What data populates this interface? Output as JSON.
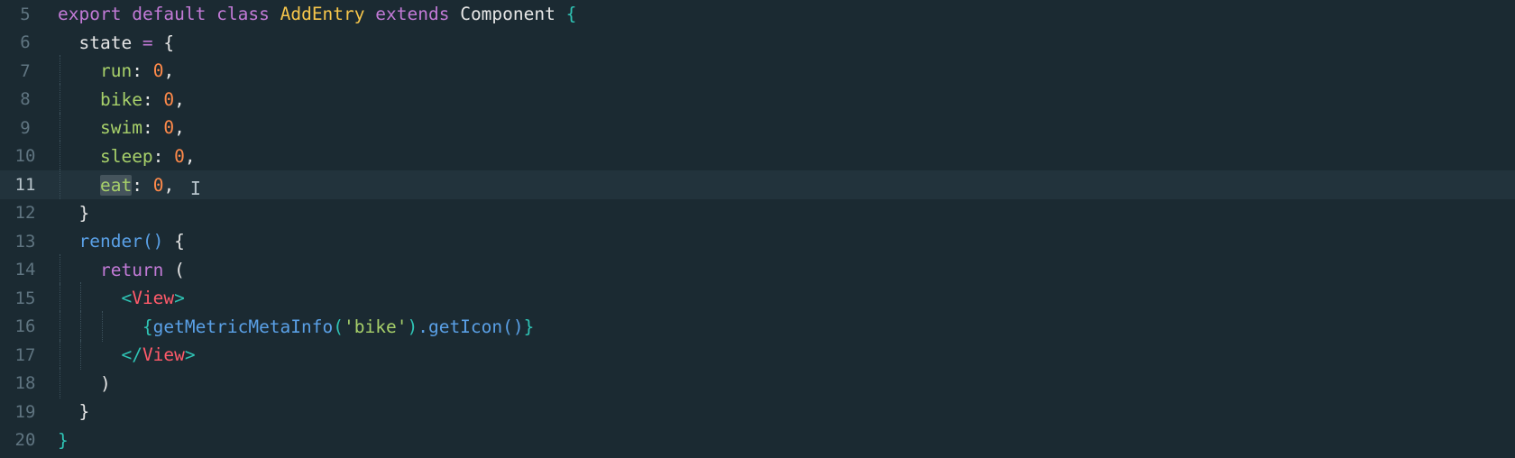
{
  "editor": {
    "active_line": "11",
    "cursor_glyph": "I",
    "lines": [
      {
        "no": "5",
        "tokens": [
          [
            "kw",
            "export"
          ],
          [
            "plain",
            " "
          ],
          [
            "kw",
            "default"
          ],
          [
            "plain",
            " "
          ],
          [
            "kw",
            "class"
          ],
          [
            "plain",
            " "
          ],
          [
            "cls",
            "AddEntry"
          ],
          [
            "plain",
            " "
          ],
          [
            "kw",
            "extends"
          ],
          [
            "plain",
            " "
          ],
          [
            "plain",
            "Component"
          ],
          [
            "plain",
            " "
          ],
          [
            "brace",
            "{"
          ]
        ]
      },
      {
        "no": "6",
        "tokens": [
          [
            "plain",
            "  state "
          ],
          [
            "op",
            "="
          ],
          [
            "plain",
            " {"
          ]
        ]
      },
      {
        "no": "7",
        "tokens": [
          [
            "plain",
            "    "
          ],
          [
            "prop",
            "run"
          ],
          [
            "punct",
            ": "
          ],
          [
            "num",
            "0"
          ],
          [
            "punct",
            ","
          ]
        ]
      },
      {
        "no": "8",
        "tokens": [
          [
            "plain",
            "    "
          ],
          [
            "prop",
            "bike"
          ],
          [
            "punct",
            ": "
          ],
          [
            "num",
            "0"
          ],
          [
            "punct",
            ","
          ]
        ]
      },
      {
        "no": "9",
        "tokens": [
          [
            "plain",
            "    "
          ],
          [
            "prop",
            "swim"
          ],
          [
            "punct",
            ": "
          ],
          [
            "num",
            "0"
          ],
          [
            "punct",
            ","
          ]
        ]
      },
      {
        "no": "10",
        "tokens": [
          [
            "plain",
            "    "
          ],
          [
            "prop",
            "sleep"
          ],
          [
            "punct",
            ": "
          ],
          [
            "num",
            "0"
          ],
          [
            "punct",
            ","
          ]
        ]
      },
      {
        "no": "11",
        "tokens": [
          [
            "plain",
            "    "
          ],
          [
            "prop sel",
            "eat"
          ],
          [
            "punct",
            ": "
          ],
          [
            "num",
            "0"
          ],
          [
            "punct",
            ", "
          ]
        ]
      },
      {
        "no": "12",
        "tokens": [
          [
            "plain",
            "  }"
          ]
        ]
      },
      {
        "no": "13",
        "tokens": [
          [
            "plain",
            "  "
          ],
          [
            "fn",
            "render"
          ],
          [
            "fn",
            "()"
          ],
          [
            "plain",
            " {"
          ]
        ]
      },
      {
        "no": "14",
        "tokens": [
          [
            "plain",
            "    "
          ],
          [
            "kw",
            "return"
          ],
          [
            "plain",
            " ("
          ]
        ]
      },
      {
        "no": "15",
        "tokens": [
          [
            "plain",
            "      "
          ],
          [
            "brace",
            "<"
          ],
          [
            "tag",
            "View"
          ],
          [
            "brace",
            ">"
          ]
        ]
      },
      {
        "no": "16",
        "tokens": [
          [
            "plain",
            "        "
          ],
          [
            "brace",
            "{"
          ],
          [
            "fn",
            "getMetricMetaInfo"
          ],
          [
            "brace",
            "("
          ],
          [
            "str",
            "'bike'"
          ],
          [
            "brace",
            ")"
          ],
          [
            "fn",
            ".getIcon"
          ],
          [
            "fn",
            "()"
          ],
          [
            "brace",
            "}"
          ]
        ]
      },
      {
        "no": "17",
        "tokens": [
          [
            "plain",
            "      "
          ],
          [
            "brace",
            "</"
          ],
          [
            "tag",
            "View"
          ],
          [
            "brace",
            ">"
          ]
        ]
      },
      {
        "no": "18",
        "tokens": [
          [
            "plain",
            "    )"
          ]
        ]
      },
      {
        "no": "19",
        "tokens": [
          [
            "plain",
            "  }"
          ]
        ]
      },
      {
        "no": "20",
        "tokens": [
          [
            "brace",
            "}"
          ]
        ]
      }
    ]
  }
}
